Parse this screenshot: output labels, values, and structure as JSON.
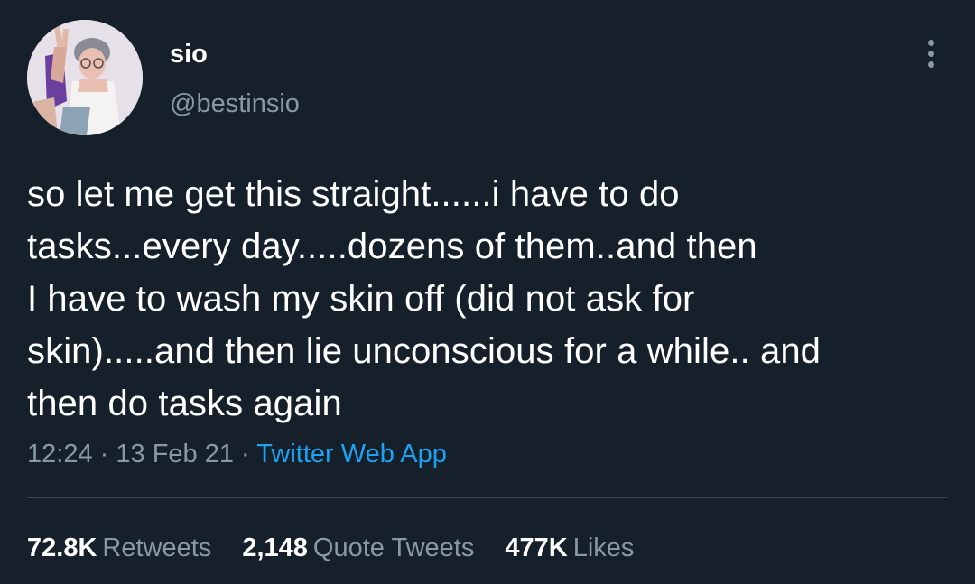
{
  "user": {
    "display_name": "sio",
    "handle": "@bestinsio"
  },
  "tweet": {
    "text": "so let me get this straight......i have to do\ntasks...every day.....dozens of them..and then\nI have to wash my skin off (did not ask for\nskin).....and then lie unconscious for a while.. and\nthen do tasks again",
    "time": "12:24",
    "separator": "·",
    "date": "13 Feb 21",
    "source": "Twitter Web App"
  },
  "stats": {
    "retweets_count": "72.8K",
    "retweets_label": "Retweets",
    "quote_count": "2,148",
    "quote_label": "Quote Tweets",
    "likes_count": "477K",
    "likes_label": "Likes"
  },
  "icons": {
    "more": "more-vertical-icon"
  },
  "colors": {
    "background": "#15202b",
    "text_primary": "#ffffff",
    "text_secondary": "#8899a6",
    "link": "#1da1f2",
    "divider": "#38444d"
  }
}
